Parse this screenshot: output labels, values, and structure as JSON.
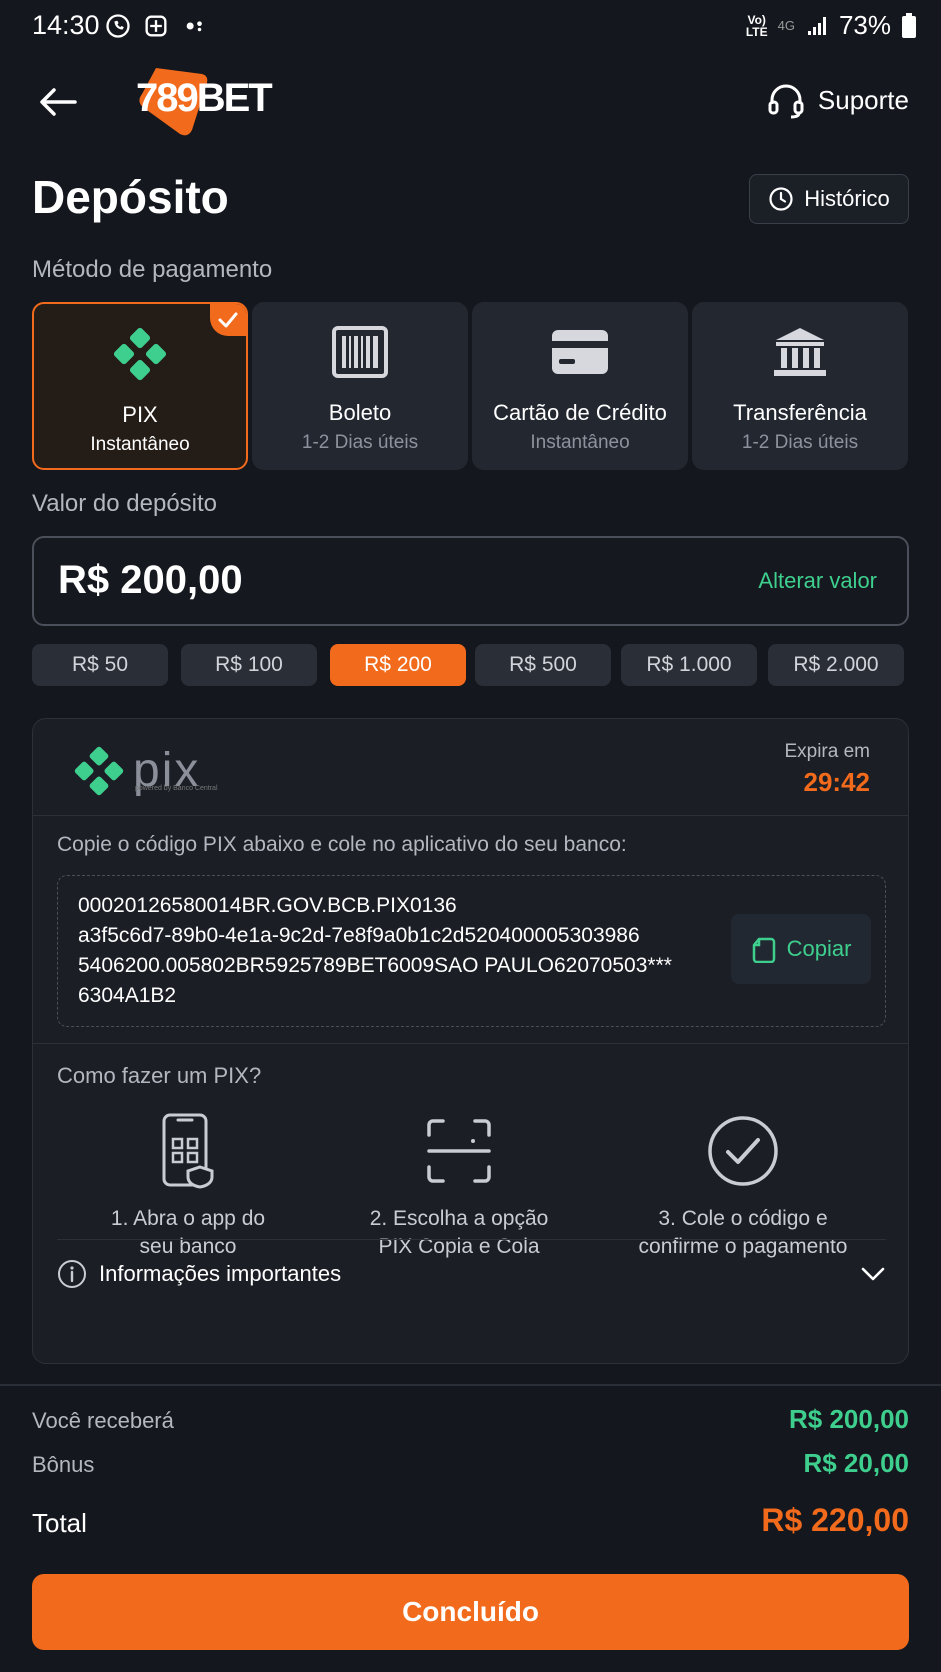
{
  "status_bar": {
    "time": "14:30",
    "network": "4G",
    "battery": "73%"
  },
  "header": {
    "logo_text": "789BET",
    "support_label": "Suporte"
  },
  "page": {
    "title": "Depósito",
    "history_label": "Histórico"
  },
  "payment": {
    "section_label": "Método de pagamento",
    "methods": [
      {
        "name": "PIX",
        "sub": "Instantâneo",
        "icon": "pix-icon",
        "selected": true
      },
      {
        "name": "Boleto",
        "sub": "1-2 Dias úteis",
        "icon": "barcode-icon",
        "selected": false
      },
      {
        "name": "Cartão de Crédito",
        "sub": "Instantâneo",
        "icon": "credit-card-icon",
        "selected": false
      },
      {
        "name": "Transferência",
        "sub": "1-2 Dias úteis",
        "icon": "bank-icon",
        "selected": false
      }
    ]
  },
  "amount": {
    "section_label": "Valor do depósito",
    "value": "R$ 200,00",
    "alter_label": "Alterar valor",
    "chips": [
      "R$ 50",
      "R$ 100",
      "R$ 200",
      "R$ 500",
      "R$ 1.000",
      "R$ 2.000"
    ],
    "active_chip": 2
  },
  "pix": {
    "logo_word": "pix",
    "powered_by": "powered by Banco Central",
    "expira_label": "Expira em",
    "expira_time": "29:42",
    "copy_instruction": "Copie o código PIX abaixo e cole no aplicativo do seu banco:",
    "code_lines": [
      "00020126580014BR.GOV.BCB.PIX0136",
      "a3f5c6d7-89b0-4e1a-9c2d-7e8f9a0b1c2d520400005303986",
      "5406200.005802BR5925789BET6009SAO PAULO62070503***",
      "6304A1B2"
    ],
    "copy_label": "Copiar",
    "howto_title": "Como fazer um PIX?",
    "steps": [
      {
        "line1": "1. Abra o app do",
        "line2": "seu banco",
        "icon": "phone-app-icon"
      },
      {
        "line1": "2. Escolha a opção",
        "line2": "PIX Copia e Cola",
        "icon": "scan-icon"
      },
      {
        "line1": "3. Cole o código e",
        "line2": "confirme o pagamento",
        "icon": "check-circle-icon"
      }
    ],
    "info_label": "Informações importantes"
  },
  "summary": {
    "receive_label": "Você receberá",
    "receive_value": "R$ 200,00",
    "bonus_label": "Bônus",
    "bonus_value": "R$ 20,00",
    "total_label": "Total",
    "total_value": "R$ 220,00"
  },
  "done_label": "Concluído",
  "colors": {
    "accent": "#f26a1b",
    "green": "#3ecf8e",
    "background": "#14171d"
  }
}
